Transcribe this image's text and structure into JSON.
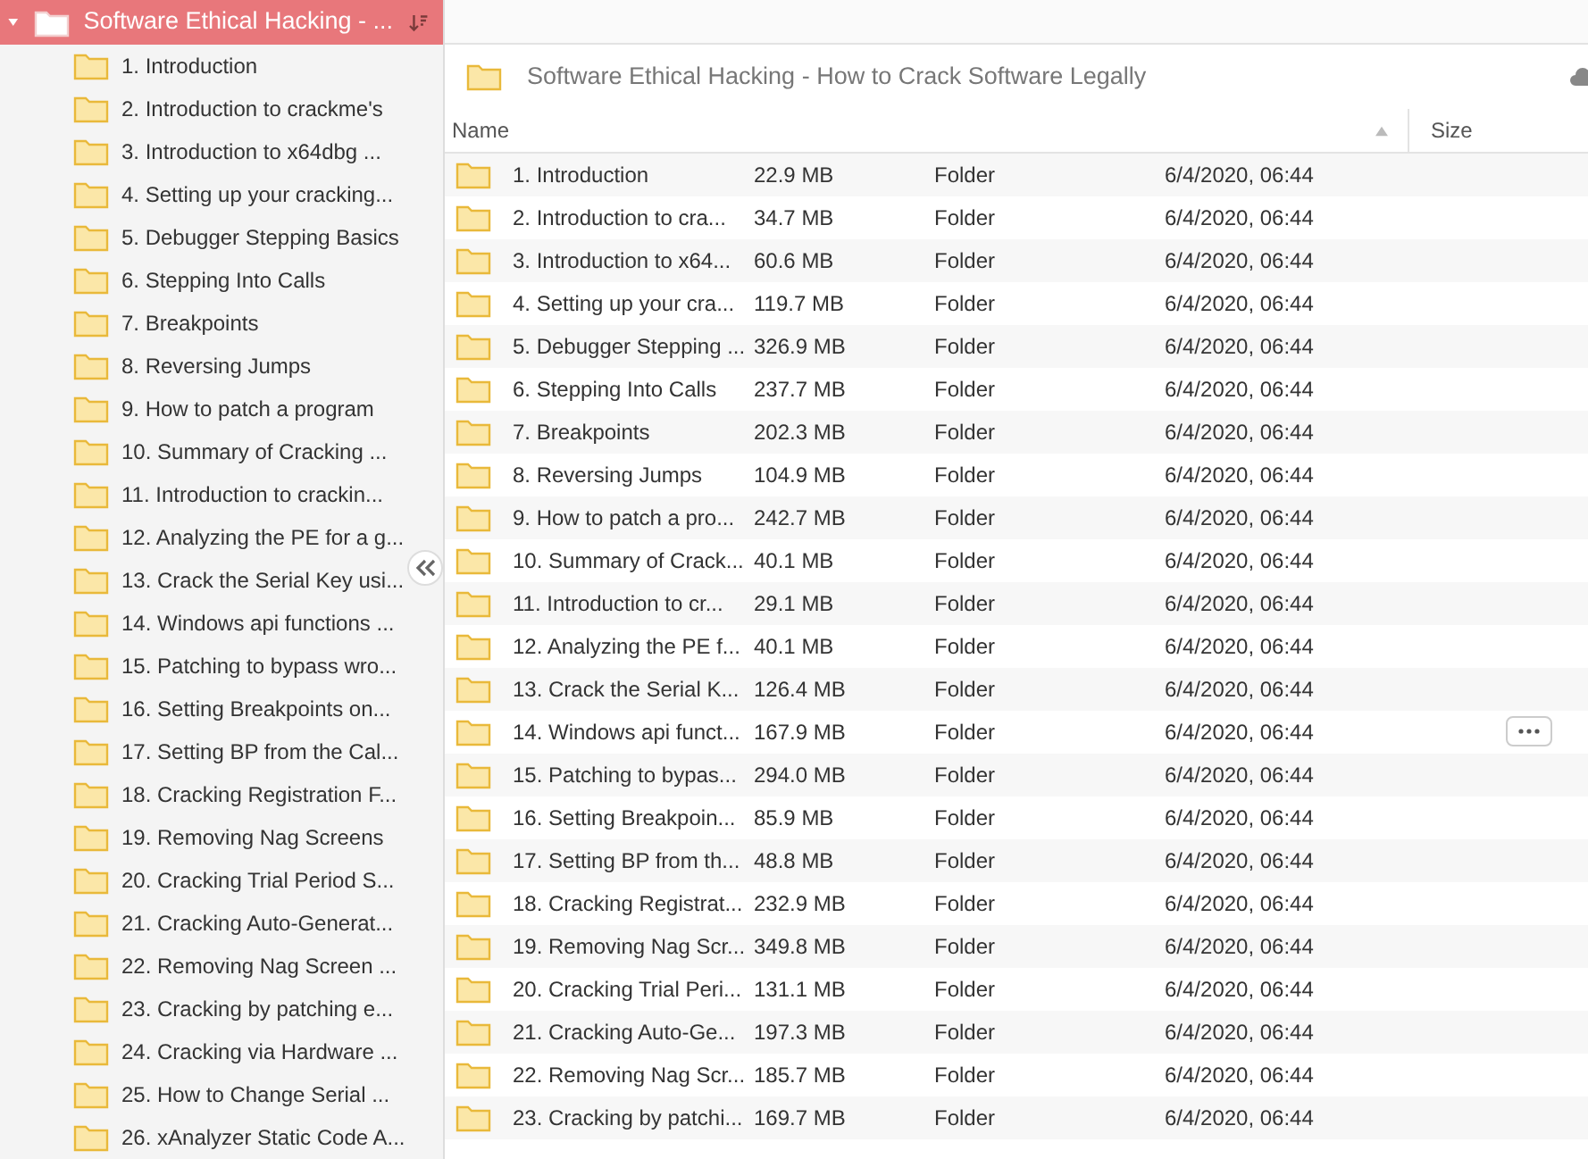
{
  "tree": {
    "label": "Software Ethical Hacking - ...",
    "expanded": true,
    "selected": true,
    "children": [
      {
        "label": "1. Introduction"
      },
      {
        "label": "2. Introduction to crackme's"
      },
      {
        "label": "3. Introduction to x64dbg ..."
      },
      {
        "label": "4. Setting up your cracking..."
      },
      {
        "label": "5. Debugger Stepping Basics"
      },
      {
        "label": "6. Stepping Into Calls"
      },
      {
        "label": "7. Breakpoints"
      },
      {
        "label": "8. Reversing Jumps"
      },
      {
        "label": "9. How to patch a program"
      },
      {
        "label": "10. Summary of Cracking ..."
      },
      {
        "label": "11. Introduction to crackin..."
      },
      {
        "label": "12. Analyzing the PE for a g..."
      },
      {
        "label": "13. Crack the Serial Key usi..."
      },
      {
        "label": "14. Windows api functions ..."
      },
      {
        "label": "15. Patching to bypass wro..."
      },
      {
        "label": "16. Setting Breakpoints on..."
      },
      {
        "label": "17. Setting BP from the Cal..."
      },
      {
        "label": "18. Cracking Registration F..."
      },
      {
        "label": "19. Removing Nag Screens"
      },
      {
        "label": "20. Cracking Trial Period S..."
      },
      {
        "label": "21. Cracking Auto-Generat..."
      },
      {
        "label": "22. Removing Nag Screen ..."
      },
      {
        "label": "23. Cracking by patching e..."
      },
      {
        "label": "24. Cracking via Hardware ..."
      },
      {
        "label": "25. How to Change Serial ..."
      },
      {
        "label": "26. xAnalyzer Static Code A..."
      }
    ]
  },
  "breadcrumb": "Software Ethical Hacking - How to Crack Software Legally",
  "table": {
    "columns": [
      {
        "label": "Name",
        "sorted": true
      },
      {
        "label": "Size",
        "sorted": false
      }
    ],
    "rows": [
      {
        "name": "1. Introduction",
        "size": "22.9 MB",
        "kind": "Folder",
        "date": "6/4/2020, 06:44",
        "hovered": false
      },
      {
        "name": "2. Introduction to cra...",
        "size": "34.7 MB",
        "kind": "Folder",
        "date": "6/4/2020, 06:44",
        "hovered": false
      },
      {
        "name": "3. Introduction to x64...",
        "size": "60.6 MB",
        "kind": "Folder",
        "date": "6/4/2020, 06:44",
        "hovered": false
      },
      {
        "name": "4. Setting up your cra...",
        "size": "119.7 MB",
        "kind": "Folder",
        "date": "6/4/2020, 06:44",
        "hovered": false
      },
      {
        "name": "5. Debugger Stepping ...",
        "size": "326.9 MB",
        "kind": "Folder",
        "date": "6/4/2020, 06:44",
        "hovered": false
      },
      {
        "name": "6. Stepping Into Calls",
        "size": "237.7 MB",
        "kind": "Folder",
        "date": "6/4/2020, 06:44",
        "hovered": false
      },
      {
        "name": "7. Breakpoints",
        "size": "202.3 MB",
        "kind": "Folder",
        "date": "6/4/2020, 06:44",
        "hovered": false
      },
      {
        "name": "8. Reversing Jumps",
        "size": "104.9 MB",
        "kind": "Folder",
        "date": "6/4/2020, 06:44",
        "hovered": false
      },
      {
        "name": "9. How to patch a pro...",
        "size": "242.7 MB",
        "kind": "Folder",
        "date": "6/4/2020, 06:44",
        "hovered": false
      },
      {
        "name": "10. Summary of Crack...",
        "size": "40.1 MB",
        "kind": "Folder",
        "date": "6/4/2020, 06:44",
        "hovered": false
      },
      {
        "name": "11. Introduction to cr...",
        "size": "29.1 MB",
        "kind": "Folder",
        "date": "6/4/2020, 06:44",
        "hovered": false
      },
      {
        "name": "12. Analyzing the PE f...",
        "size": "40.1 MB",
        "kind": "Folder",
        "date": "6/4/2020, 06:44",
        "hovered": false
      },
      {
        "name": "13. Crack the Serial K...",
        "size": "126.4 MB",
        "kind": "Folder",
        "date": "6/4/2020, 06:44",
        "hovered": false
      },
      {
        "name": "14. Windows api funct...",
        "size": "167.9 MB",
        "kind": "Folder",
        "date": "6/4/2020, 06:44",
        "hovered": true
      },
      {
        "name": "15. Patching to bypas...",
        "size": "294.0 MB",
        "kind": "Folder",
        "date": "6/4/2020, 06:44",
        "hovered": false
      },
      {
        "name": "16. Setting Breakpoin...",
        "size": "85.9 MB",
        "kind": "Folder",
        "date": "6/4/2020, 06:44",
        "hovered": false
      },
      {
        "name": "17. Setting BP from th...",
        "size": "48.8 MB",
        "kind": "Folder",
        "date": "6/4/2020, 06:44",
        "hovered": false
      },
      {
        "name": "18. Cracking Registrat...",
        "size": "232.9 MB",
        "kind": "Folder",
        "date": "6/4/2020, 06:44",
        "hovered": false
      },
      {
        "name": "19. Removing Nag Scr...",
        "size": "349.8 MB",
        "kind": "Folder",
        "date": "6/4/2020, 06:44",
        "hovered": false
      },
      {
        "name": "20. Cracking Trial Peri...",
        "size": "131.1 MB",
        "kind": "Folder",
        "date": "6/4/2020, 06:44",
        "hovered": false
      },
      {
        "name": "21. Cracking Auto-Ge...",
        "size": "197.3 MB",
        "kind": "Folder",
        "date": "6/4/2020, 06:44",
        "hovered": false
      },
      {
        "name": "22. Removing Nag Scr...",
        "size": "185.7 MB",
        "kind": "Folder",
        "date": "6/4/2020, 06:44",
        "hovered": false
      },
      {
        "name": "23. Cracking by patchi...",
        "size": "169.7 MB",
        "kind": "Folder",
        "date": "6/4/2020, 06:44",
        "hovered": false
      }
    ]
  }
}
